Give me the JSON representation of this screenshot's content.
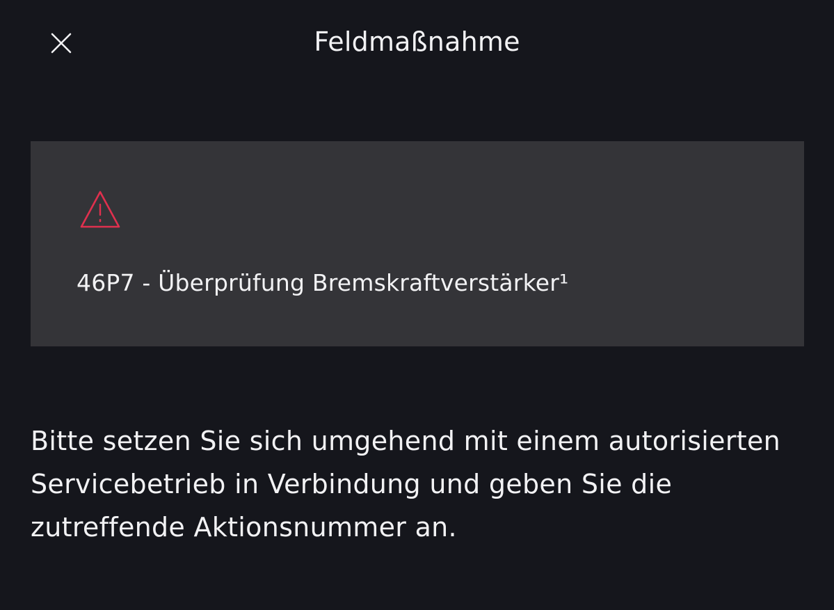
{
  "header": {
    "title": "Feldmaßnahme",
    "close_icon": "close-icon"
  },
  "card": {
    "icon": "warning-triangle-icon",
    "icon_color": "#e0304e",
    "text": "46P7 - Überprüfung Bremskraftverstärker¹"
  },
  "message": {
    "text": "Bitte setzen Sie sich umgehend mit einem autorisierten Servicebetrieb in Verbindung und geben Sie die zutreffende Aktionsnummer an."
  },
  "colors": {
    "background": "#15161c",
    "card_background": "#343438",
    "text": "#f2f2f4"
  }
}
